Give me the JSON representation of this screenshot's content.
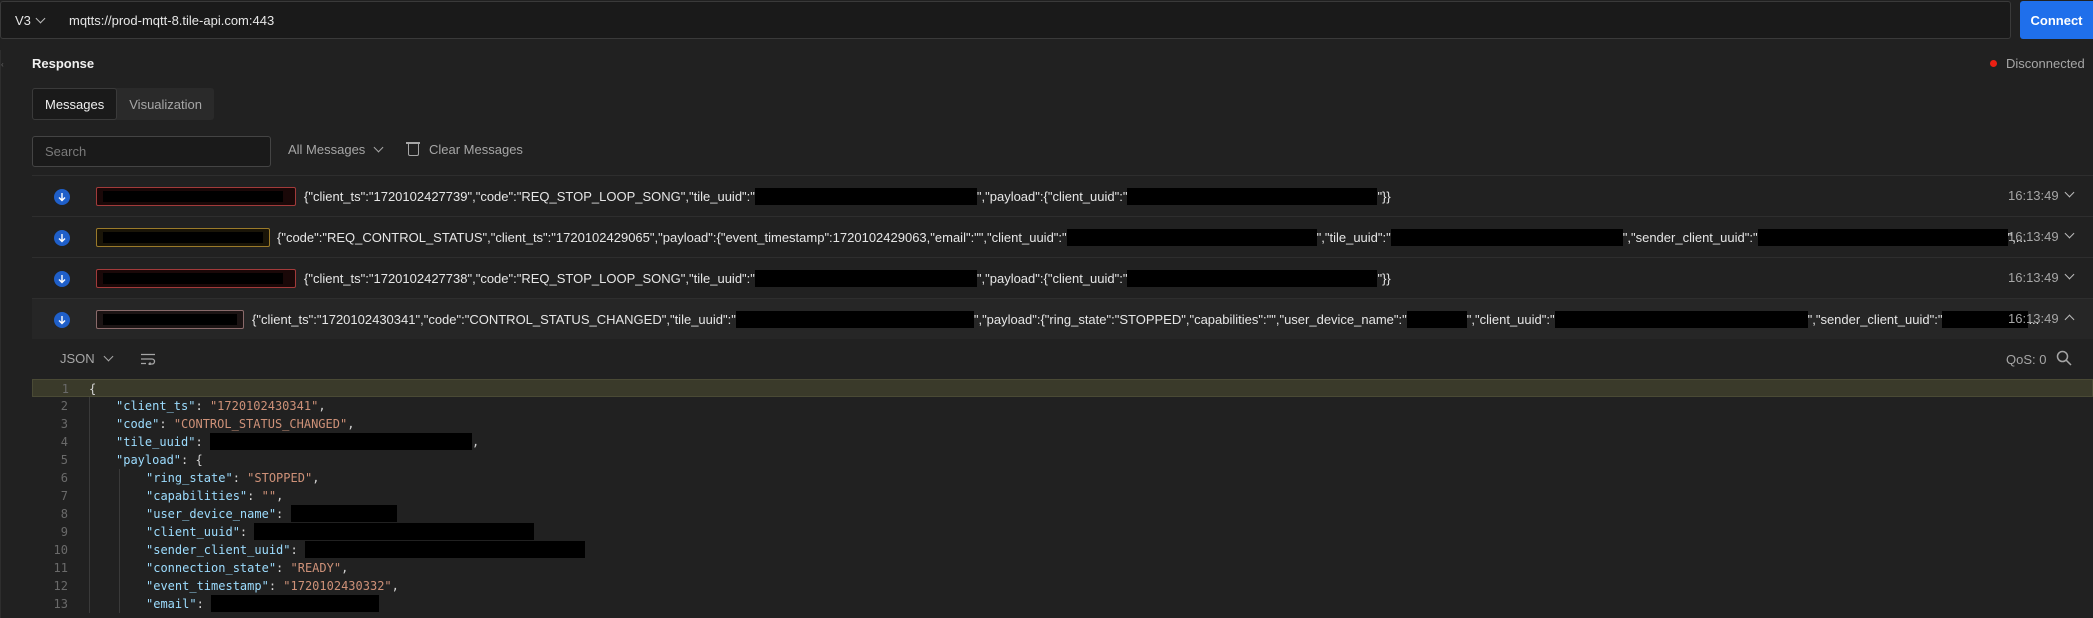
{
  "topbar": {
    "version": "V3",
    "url": "mqtts://prod-mqtt-8.tile-api.com:443",
    "connect_label": "Connect"
  },
  "response": {
    "title": "Response",
    "status": "Disconnected",
    "status_color": "#eb2013"
  },
  "tabs": [
    {
      "label": "Messages",
      "active": true
    },
    {
      "label": "Visualization",
      "active": false
    }
  ],
  "search": {
    "placeholder": "Search"
  },
  "filter_label": "All Messages",
  "clear_label": "Clear Messages",
  "messages": [
    {
      "time": "16:13:49",
      "p1": "{\"client_ts\":\"1720102427739\",\"code\":\"REQ_STOP_LOOP_SONG\",\"tile_uuid\":\"",
      "p2": "\",\"payload\":{\"client_uuid\":\"",
      "p3": "\"}}"
    },
    {
      "time": "16:13:49",
      "p1": "{\"code\":\"REQ_CONTROL_STATUS\",\"client_ts\":\"1720102429065\",\"payload\":{\"event_timestamp\":1720102429063,\"email\":\"\",\"client_uuid\":\"",
      "p2": "\",\"tile_uuid\":\"",
      "p3": "\",\"sender_client_uuid\":\"",
      "p4": "\",..."
    },
    {
      "time": "16:13:49",
      "p1": "{\"client_ts\":\"1720102427738\",\"code\":\"REQ_STOP_LOOP_SONG\",\"tile_uuid\":\"",
      "p2": "\",\"payload\":{\"client_uuid\":\"",
      "p3": "\"}}"
    },
    {
      "time": "16:13:49",
      "p1": "{\"client_ts\":\"1720102430341\",\"code\":\"CONTROL_STATUS_CHANGED\",\"tile_uuid\":\"",
      "p2": "\",\"payload\":{\"ring_state\":\"STOPPED\",\"capabilities\":\"\",\"user_device_name\":\"",
      "p3": "\",\"client_uuid\":\"",
      "p4": "\",\"sender_client_uuid\":\"",
      "p5": "..."
    }
  ],
  "detail": {
    "format": "JSON",
    "qos": "QoS: 0",
    "lines": [
      {
        "n": "1",
        "indent": 0,
        "key": "",
        "val": "",
        "open": "{"
      },
      {
        "n": "2",
        "indent": 1,
        "key": "\"client_ts\"",
        "val": "\"1720102430341\"",
        "tail": ","
      },
      {
        "n": "3",
        "indent": 1,
        "key": "\"code\"",
        "val": "\"CONTROL_STATUS_CHANGED\"",
        "tail": ","
      },
      {
        "n": "4",
        "indent": 1,
        "key": "\"tile_uuid\"",
        "val": "",
        "tail": ","
      },
      {
        "n": "5",
        "indent": 1,
        "key": "\"payload\"",
        "val": "",
        "open": "{"
      },
      {
        "n": "6",
        "indent": 2,
        "key": "\"ring_state\"",
        "val": "\"STOPPED\"",
        "tail": ","
      },
      {
        "n": "7",
        "indent": 2,
        "key": "\"capabilities\"",
        "val": "\"\"",
        "tail": ","
      },
      {
        "n": "8",
        "indent": 2,
        "key": "\"user_device_name\"",
        "val": "",
        "tail": ""
      },
      {
        "n": "9",
        "indent": 2,
        "key": "\"client_uuid\"",
        "val": "",
        "tail": ""
      },
      {
        "n": "10",
        "indent": 2,
        "key": "\"sender_client_uuid\"",
        "val": "",
        "tail": ""
      },
      {
        "n": "11",
        "indent": 2,
        "key": "\"connection_state\"",
        "val": "\"READY\"",
        "tail": ","
      },
      {
        "n": "12",
        "indent": 2,
        "key": "\"event_timestamp\"",
        "val": "\"1720102430332\"",
        "tail": ","
      },
      {
        "n": "13",
        "indent": 2,
        "key": "\"email\"",
        "val": "",
        "tail": ""
      }
    ]
  },
  "colors": {
    "accent": "#1f6feb",
    "json_key": "#9cdcfe",
    "json_string": "#ce9178"
  }
}
